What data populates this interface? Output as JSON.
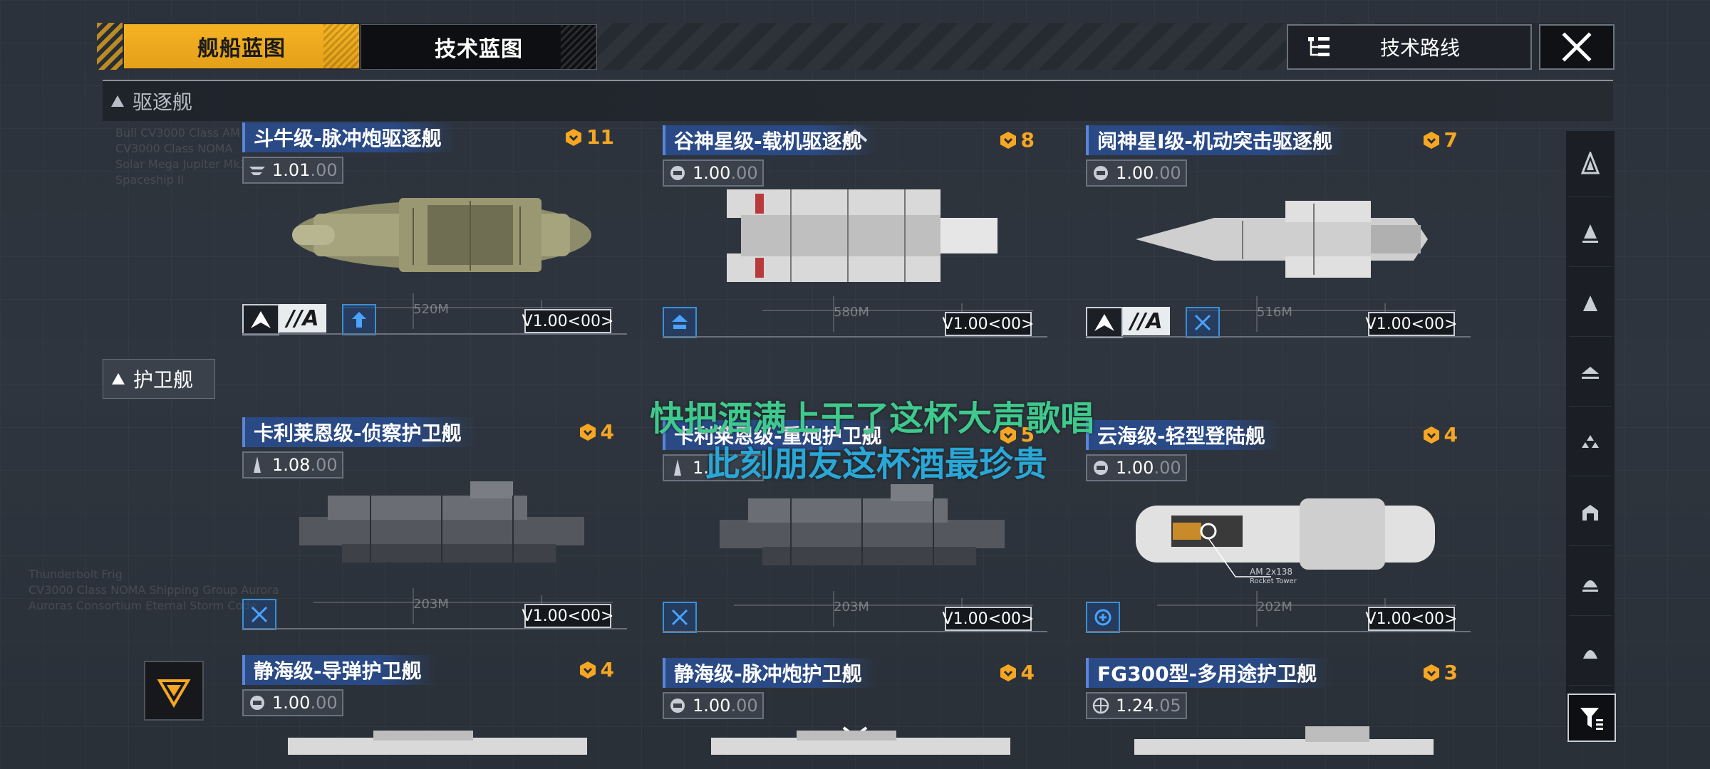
{
  "tabs": {
    "ship_blueprint": "舰船蓝图",
    "tech_blueprint": "技术蓝图"
  },
  "tech_route": "技术路线",
  "sections": {
    "destroyer": "驱逐舰",
    "frigate": "护卫舰"
  },
  "ships": [
    {
      "name": "斗牛级-脉冲炮驱逐舰",
      "cost": "11",
      "ver": "1.01",
      "ver_dim": ".00",
      "grade": "//A",
      "version_tag": "V1.00<00>",
      "length": "520M"
    },
    {
      "name": "谷神星级-载机驱逐舰",
      "cost": "8",
      "ver": "1.00",
      "ver_dim": ".00",
      "grade": "",
      "version_tag": "V1.00<00>",
      "length": "580M"
    },
    {
      "name": "阋神星I级-机动突击驱逐舰",
      "cost": "7",
      "ver": "1.00",
      "ver_dim": ".00",
      "grade": "//A",
      "version_tag": "V1.00<00>",
      "length": "516M"
    },
    {
      "name": "卡利莱恩级-侦察护卫舰",
      "cost": "4",
      "ver": "1.08",
      "ver_dim": ".00",
      "grade": "",
      "version_tag": "V1.00<00>",
      "length": "203M"
    },
    {
      "name": "卡利莱恩级-重炮护卫舰",
      "cost": "5",
      "ver": "1.",
      "ver_dim": "",
      "grade": "",
      "version_tag": "V1.00<00>",
      "length": "203M"
    },
    {
      "name": "云海级-轻型登陆舰",
      "cost": "4",
      "ver": "1.00",
      "ver_dim": ".00",
      "grade": "",
      "version_tag": "V1.00<00>",
      "length": "202M"
    },
    {
      "name": "静海级-导弹护卫舰",
      "cost": "4",
      "ver": "1.00",
      "ver_dim": ".00",
      "grade": "",
      "version_tag": "",
      "length": ""
    },
    {
      "name": "静海级-脉冲炮护卫舰",
      "cost": "4",
      "ver": "1.00",
      "ver_dim": ".00",
      "grade": "",
      "version_tag": "",
      "length": ""
    },
    {
      "name": "FG300型-多用途护卫舰",
      "cost": "3",
      "ver": "1.24",
      "ver_dim": ".05",
      "grade": "",
      "version_tag": "",
      "length": ""
    }
  ],
  "annotation": "AM 2x138",
  "annotation_sub": "Rocket Tower",
  "lyrics": {
    "line1": "快把酒满上干了这杯大声歌唱",
    "line2": "此刻朋友这杯酒最珍贵"
  },
  "ghost_text_1": "Bull CV3000 Class AM\nCV3000 Class NOMA\nSolar Mega Jupiter Mk2\nSpaceship Il",
  "ghost_text_2": "Thunderbolt Frig\nCV3000 Class NOMA Shipping Group Aurora\nAuroras Consortium Eternal Storm Code",
  "colors": {
    "accent": "#f5b323",
    "name_bar": "#2a4a86",
    "cost": "#f5a623",
    "lyric1": "#3fc98d",
    "lyric2": "#2aa7d6"
  }
}
